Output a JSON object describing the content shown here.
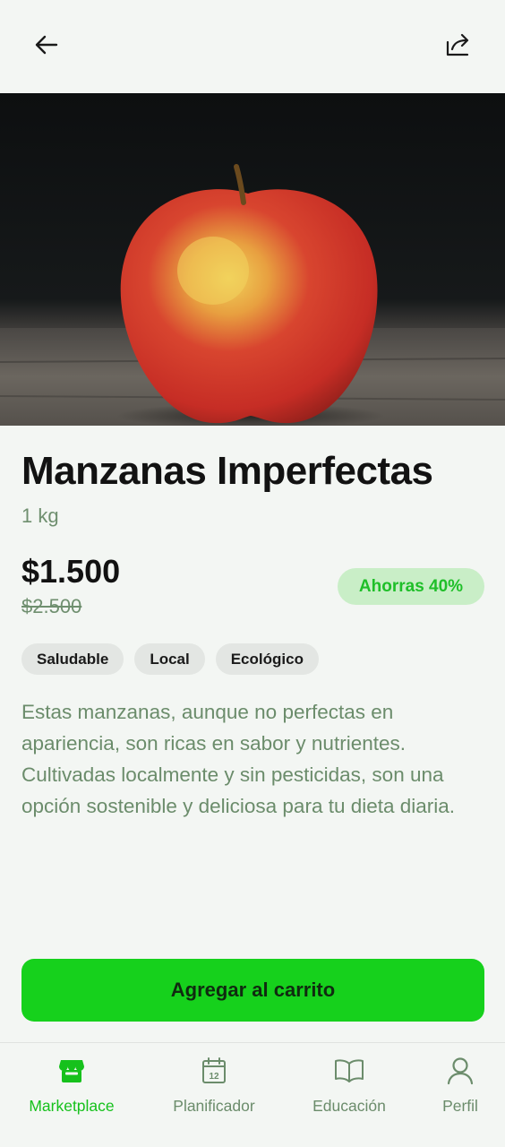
{
  "header": {
    "back_icon": "arrow-left-icon",
    "share_icon": "share-icon"
  },
  "product": {
    "name": "Manzanas Imperfectas",
    "weight": "1 kg",
    "price": "$1.500",
    "original_price": "$2.500",
    "savings_badge": "Ahorras 40%",
    "tags": [
      "Saludable",
      "Local",
      "Ecológico"
    ],
    "description": "Estas manzanas, aunque no perfectas en apariencia, son ricas en sabor y nutrientes. Cultivadas localmente y sin pesticidas, son una opción sostenible y deliciosa para tu dieta diaria."
  },
  "actions": {
    "add_to_cart": "Agregar al carrito"
  },
  "nav": {
    "items": [
      {
        "label": "Marketplace",
        "icon": "store-icon",
        "active": true
      },
      {
        "label": "Planificador",
        "icon": "calendar-icon",
        "active": false
      },
      {
        "label": "Educación",
        "icon": "book-icon",
        "active": false
      },
      {
        "label": "Perfil",
        "icon": "user-icon",
        "active": false
      }
    ],
    "calendar_day": "12"
  },
  "colors": {
    "accent": "#16d11c",
    "accent_text": "#1fbf29",
    "muted_green": "#6b8c6b",
    "background": "#f3f6f3"
  }
}
